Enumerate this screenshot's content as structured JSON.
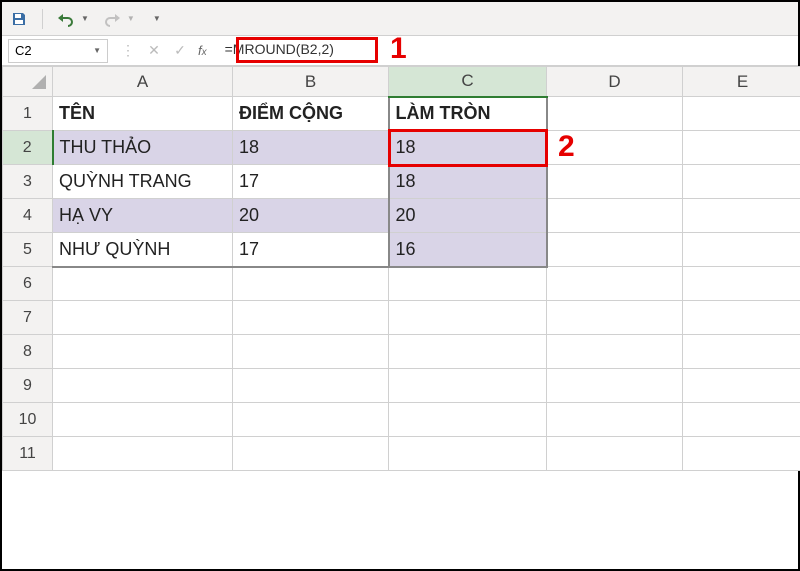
{
  "qat": {
    "save": "save-icon",
    "undo": "undo-icon",
    "redo": "redo-icon"
  },
  "namebox": {
    "value": "C2"
  },
  "formula": {
    "value": "=MROUND(B2,2)"
  },
  "annotations": {
    "one": "1",
    "two": "2"
  },
  "columns": [
    "A",
    "B",
    "C",
    "D",
    "E"
  ],
  "rows": [
    "1",
    "2",
    "3",
    "4",
    "5",
    "6",
    "7",
    "8",
    "9",
    "10",
    "11"
  ],
  "headers": {
    "A": "TÊN",
    "B": "ĐIỂM CỘNG",
    "C": "LÀM TRÒN"
  },
  "data": [
    {
      "name": "THU THẢO",
      "score": "18",
      "rounded": "18"
    },
    {
      "name": "QUỲNH TRANG",
      "score": "17",
      "rounded": "18"
    },
    {
      "name": "HẠ VY",
      "score": "20",
      "rounded": "20"
    },
    {
      "name": "NHƯ QUỲNH",
      "score": "17",
      "rounded": "16"
    }
  ],
  "chart_data": {
    "type": "table",
    "columns": [
      "TÊN",
      "ĐIỂM CỘNG",
      "LÀM TRÒN"
    ],
    "rows": [
      [
        "THU THẢO",
        18,
        18
      ],
      [
        "QUỲNH TRANG",
        17,
        18
      ],
      [
        "HẠ VY",
        20,
        20
      ],
      [
        "NHƯ QUỲNH",
        17,
        16
      ]
    ]
  }
}
